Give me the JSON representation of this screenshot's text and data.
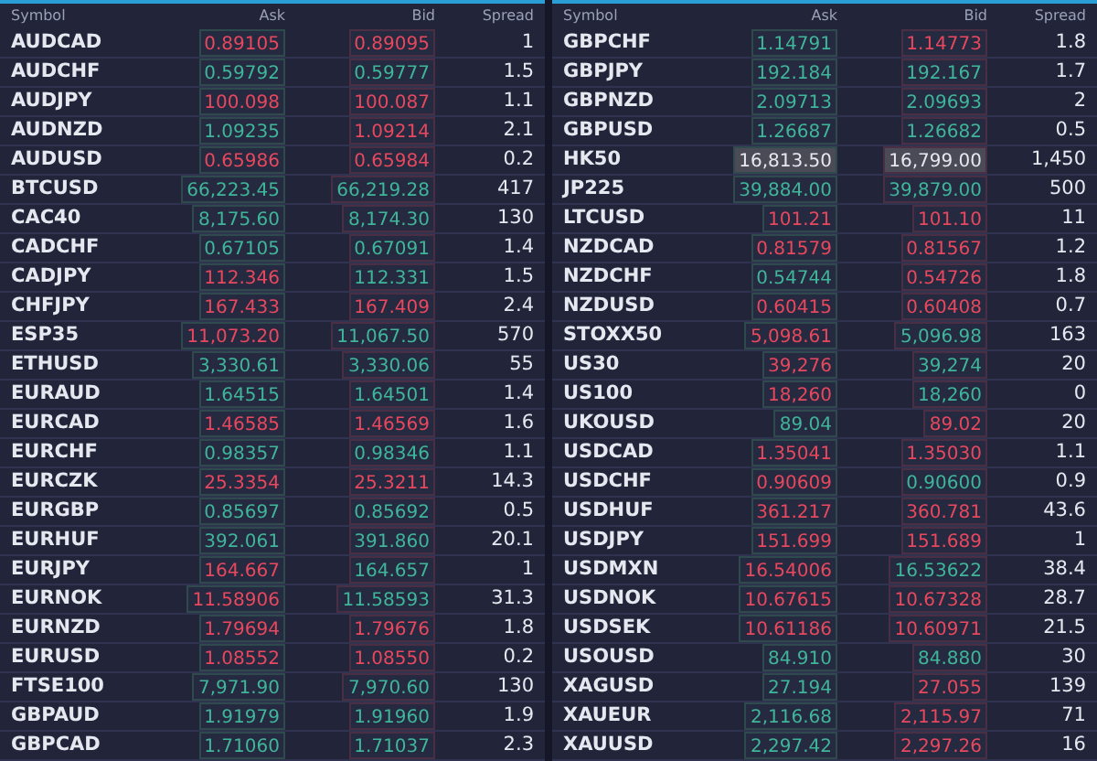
{
  "panels": [
    {
      "columns": [
        "Symbol",
        "Ask",
        "Bid",
        "Spread"
      ],
      "rows": [
        {
          "symbol": "AUDCAD",
          "ask": {
            "text": "0.89105",
            "color": "#e8485e"
          },
          "bid": {
            "text": "0.89095",
            "color": "#e8485e"
          },
          "spread": "1",
          "highlighted": false
        },
        {
          "symbol": "AUDCHF",
          "ask": {
            "text": "0.59792",
            "color": "#3fb59a"
          },
          "bid": {
            "text": "0.59777",
            "color": "#3fb59a"
          },
          "spread": "1.5",
          "highlighted": false
        },
        {
          "symbol": "AUDJPY",
          "ask": {
            "text": "100.098",
            "color": "#e8485e"
          },
          "bid": {
            "text": "100.087",
            "color": "#e8485e"
          },
          "spread": "1.1",
          "highlighted": false
        },
        {
          "symbol": "AUDNZD",
          "ask": {
            "text": "1.09235",
            "color": "#3fb59a"
          },
          "bid": {
            "text": "1.09214",
            "color": "#e8485e"
          },
          "spread": "2.1",
          "highlighted": false
        },
        {
          "symbol": "AUDUSD",
          "ask": {
            "text": "0.65986",
            "color": "#e8485e"
          },
          "bid": {
            "text": "0.65984",
            "color": "#e8485e"
          },
          "spread": "0.2",
          "highlighted": false
        },
        {
          "symbol": "BTCUSD",
          "ask": {
            "text": "66,223.45",
            "color": "#3fb59a"
          },
          "bid": {
            "text": "66,219.28",
            "color": "#3fb59a"
          },
          "spread": "417",
          "highlighted": false
        },
        {
          "symbol": "CAC40",
          "ask": {
            "text": "8,175.60",
            "color": "#3fb59a"
          },
          "bid": {
            "text": "8,174.30",
            "color": "#3fb59a"
          },
          "spread": "130",
          "highlighted": false
        },
        {
          "symbol": "CADCHF",
          "ask": {
            "text": "0.67105",
            "color": "#3fb59a"
          },
          "bid": {
            "text": "0.67091",
            "color": "#3fb59a"
          },
          "spread": "1.4",
          "highlighted": false
        },
        {
          "symbol": "CADJPY",
          "ask": {
            "text": "112.346",
            "color": "#e8485e"
          },
          "bid": {
            "text": "112.331",
            "color": "#3fb59a"
          },
          "spread": "1.5",
          "highlighted": false
        },
        {
          "symbol": "CHFJPY",
          "ask": {
            "text": "167.433",
            "color": "#e8485e"
          },
          "bid": {
            "text": "167.409",
            "color": "#e8485e"
          },
          "spread": "2.4",
          "highlighted": false
        },
        {
          "symbol": "ESP35",
          "ask": {
            "text": "11,073.20",
            "color": "#e8485e"
          },
          "bid": {
            "text": "11,067.50",
            "color": "#3fb59a"
          },
          "spread": "570",
          "highlighted": false
        },
        {
          "symbol": "ETHUSD",
          "ask": {
            "text": "3,330.61",
            "color": "#3fb59a"
          },
          "bid": {
            "text": "3,330.06",
            "color": "#3fb59a"
          },
          "spread": "55",
          "highlighted": false
        },
        {
          "symbol": "EURAUD",
          "ask": {
            "text": "1.64515",
            "color": "#3fb59a"
          },
          "bid": {
            "text": "1.64501",
            "color": "#3fb59a"
          },
          "spread": "1.4",
          "highlighted": false
        },
        {
          "symbol": "EURCAD",
          "ask": {
            "text": "1.46585",
            "color": "#e8485e"
          },
          "bid": {
            "text": "1.46569",
            "color": "#e8485e"
          },
          "spread": "1.6",
          "highlighted": false
        },
        {
          "symbol": "EURCHF",
          "ask": {
            "text": "0.98357",
            "color": "#3fb59a"
          },
          "bid": {
            "text": "0.98346",
            "color": "#3fb59a"
          },
          "spread": "1.1",
          "highlighted": false
        },
        {
          "symbol": "EURCZK",
          "ask": {
            "text": "25.3354",
            "color": "#e8485e"
          },
          "bid": {
            "text": "25.3211",
            "color": "#e8485e"
          },
          "spread": "14.3",
          "highlighted": false
        },
        {
          "symbol": "EURGBP",
          "ask": {
            "text": "0.85697",
            "color": "#3fb59a"
          },
          "bid": {
            "text": "0.85692",
            "color": "#3fb59a"
          },
          "spread": "0.5",
          "highlighted": false
        },
        {
          "symbol": "EURHUF",
          "ask": {
            "text": "392.061",
            "color": "#3fb59a"
          },
          "bid": {
            "text": "391.860",
            "color": "#3fb59a"
          },
          "spread": "20.1",
          "highlighted": false
        },
        {
          "symbol": "EURJPY",
          "ask": {
            "text": "164.667",
            "color": "#e8485e"
          },
          "bid": {
            "text": "164.657",
            "color": "#3fb59a"
          },
          "spread": "1",
          "highlighted": false
        },
        {
          "symbol": "EURNOK",
          "ask": {
            "text": "11.58906",
            "color": "#e8485e"
          },
          "bid": {
            "text": "11.58593",
            "color": "#3fb59a"
          },
          "spread": "31.3",
          "highlighted": false
        },
        {
          "symbol": "EURNZD",
          "ask": {
            "text": "1.79694",
            "color": "#e8485e"
          },
          "bid": {
            "text": "1.79676",
            "color": "#e8485e"
          },
          "spread": "1.8",
          "highlighted": false
        },
        {
          "symbol": "EURUSD",
          "ask": {
            "text": "1.08552",
            "color": "#e8485e"
          },
          "bid": {
            "text": "1.08550",
            "color": "#e8485e"
          },
          "spread": "0.2",
          "highlighted": false
        },
        {
          "symbol": "FTSE100",
          "ask": {
            "text": "7,971.90",
            "color": "#3fb59a"
          },
          "bid": {
            "text": "7,970.60",
            "color": "#3fb59a"
          },
          "spread": "130",
          "highlighted": false
        },
        {
          "symbol": "GBPAUD",
          "ask": {
            "text": "1.91979",
            "color": "#3fb59a"
          },
          "bid": {
            "text": "1.91960",
            "color": "#3fb59a"
          },
          "spread": "1.9",
          "highlighted": false
        },
        {
          "symbol": "GBPCAD",
          "ask": {
            "text": "1.71060",
            "color": "#3fb59a"
          },
          "bid": {
            "text": "1.71037",
            "color": "#3fb59a"
          },
          "spread": "2.3",
          "highlighted": false
        }
      ]
    },
    {
      "columns": [
        "Symbol",
        "Ask",
        "Bid",
        "Spread"
      ],
      "rows": [
        {
          "symbol": "GBPCHF",
          "ask": {
            "text": "1.14791",
            "color": "#3fb59a"
          },
          "bid": {
            "text": "1.14773",
            "color": "#e8485e"
          },
          "spread": "1.8",
          "highlighted": false
        },
        {
          "symbol": "GBPJPY",
          "ask": {
            "text": "192.184",
            "color": "#3fb59a"
          },
          "bid": {
            "text": "192.167",
            "color": "#3fb59a"
          },
          "spread": "1.7",
          "highlighted": false
        },
        {
          "symbol": "GBPNZD",
          "ask": {
            "text": "2.09713",
            "color": "#3fb59a"
          },
          "bid": {
            "text": "2.09693",
            "color": "#3fb59a"
          },
          "spread": "2",
          "highlighted": false
        },
        {
          "symbol": "GBPUSD",
          "ask": {
            "text": "1.26687",
            "color": "#3fb59a"
          },
          "bid": {
            "text": "1.26682",
            "color": "#3fb59a"
          },
          "spread": "0.5",
          "highlighted": false
        },
        {
          "symbol": "HK50",
          "ask": {
            "text": "16,813.50",
            "color": "#e6e8f0"
          },
          "bid": {
            "text": "16,799.00",
            "color": "#e6e8f0"
          },
          "spread": "1,450",
          "highlighted": true
        },
        {
          "symbol": "JP225",
          "ask": {
            "text": "39,884.00",
            "color": "#3fb59a"
          },
          "bid": {
            "text": "39,879.00",
            "color": "#3fb59a"
          },
          "spread": "500",
          "highlighted": false
        },
        {
          "symbol": "LTCUSD",
          "ask": {
            "text": "101.21",
            "color": "#e8485e"
          },
          "bid": {
            "text": "101.10",
            "color": "#e8485e"
          },
          "spread": "11",
          "highlighted": false
        },
        {
          "symbol": "NZDCAD",
          "ask": {
            "text": "0.81579",
            "color": "#e8485e"
          },
          "bid": {
            "text": "0.81567",
            "color": "#e8485e"
          },
          "spread": "1.2",
          "highlighted": false
        },
        {
          "symbol": "NZDCHF",
          "ask": {
            "text": "0.54744",
            "color": "#3fb59a"
          },
          "bid": {
            "text": "0.54726",
            "color": "#e8485e"
          },
          "spread": "1.8",
          "highlighted": false
        },
        {
          "symbol": "NZDUSD",
          "ask": {
            "text": "0.60415",
            "color": "#e8485e"
          },
          "bid": {
            "text": "0.60408",
            "color": "#e8485e"
          },
          "spread": "0.7",
          "highlighted": false
        },
        {
          "symbol": "STOXX50",
          "ask": {
            "text": "5,098.61",
            "color": "#e8485e"
          },
          "bid": {
            "text": "5,096.98",
            "color": "#3fb59a"
          },
          "spread": "163",
          "highlighted": false
        },
        {
          "symbol": "US30",
          "ask": {
            "text": "39,276",
            "color": "#e8485e"
          },
          "bid": {
            "text": "39,274",
            "color": "#3fb59a"
          },
          "spread": "20",
          "highlighted": false
        },
        {
          "symbol": "US100",
          "ask": {
            "text": "18,260",
            "color": "#e8485e"
          },
          "bid": {
            "text": "18,260",
            "color": "#3fb59a"
          },
          "spread": "0",
          "highlighted": false
        },
        {
          "symbol": "UKOUSD",
          "ask": {
            "text": "89.04",
            "color": "#3fb59a"
          },
          "bid": {
            "text": "89.02",
            "color": "#e8485e"
          },
          "spread": "20",
          "highlighted": false
        },
        {
          "symbol": "USDCAD",
          "ask": {
            "text": "1.35041",
            "color": "#e8485e"
          },
          "bid": {
            "text": "1.35030",
            "color": "#e8485e"
          },
          "spread": "1.1",
          "highlighted": false
        },
        {
          "symbol": "USDCHF",
          "ask": {
            "text": "0.90609",
            "color": "#e8485e"
          },
          "bid": {
            "text": "0.90600",
            "color": "#3fb59a"
          },
          "spread": "0.9",
          "highlighted": false
        },
        {
          "symbol": "USDHUF",
          "ask": {
            "text": "361.217",
            "color": "#e8485e"
          },
          "bid": {
            "text": "360.781",
            "color": "#e8485e"
          },
          "spread": "43.6",
          "highlighted": false
        },
        {
          "symbol": "USDJPY",
          "ask": {
            "text": "151.699",
            "color": "#e8485e"
          },
          "bid": {
            "text": "151.689",
            "color": "#e8485e"
          },
          "spread": "1",
          "highlighted": false
        },
        {
          "symbol": "USDMXN",
          "ask": {
            "text": "16.54006",
            "color": "#e8485e"
          },
          "bid": {
            "text": "16.53622",
            "color": "#3fb59a"
          },
          "spread": "38.4",
          "highlighted": false
        },
        {
          "symbol": "USDNOK",
          "ask": {
            "text": "10.67615",
            "color": "#e8485e"
          },
          "bid": {
            "text": "10.67328",
            "color": "#e8485e"
          },
          "spread": "28.7",
          "highlighted": false
        },
        {
          "symbol": "USDSEK",
          "ask": {
            "text": "10.61186",
            "color": "#e8485e"
          },
          "bid": {
            "text": "10.60971",
            "color": "#e8485e"
          },
          "spread": "21.5",
          "highlighted": false
        },
        {
          "symbol": "USOUSD",
          "ask": {
            "text": "84.910",
            "color": "#3fb59a"
          },
          "bid": {
            "text": "84.880",
            "color": "#3fb59a"
          },
          "spread": "30",
          "highlighted": false
        },
        {
          "symbol": "XAGUSD",
          "ask": {
            "text": "27.194",
            "color": "#3fb59a"
          },
          "bid": {
            "text": "27.055",
            "color": "#e8485e"
          },
          "spread": "139",
          "highlighted": false
        },
        {
          "symbol": "XAUEUR",
          "ask": {
            "text": "2,116.68",
            "color": "#3fb59a"
          },
          "bid": {
            "text": "2,115.97",
            "color": "#e8485e"
          },
          "spread": "71",
          "highlighted": false
        },
        {
          "symbol": "XAUUSD",
          "ask": {
            "text": "2,297.42",
            "color": "#3fb59a"
          },
          "bid": {
            "text": "2,297.26",
            "color": "#e8485e"
          },
          "spread": "16",
          "highlighted": false
        }
      ]
    }
  ]
}
